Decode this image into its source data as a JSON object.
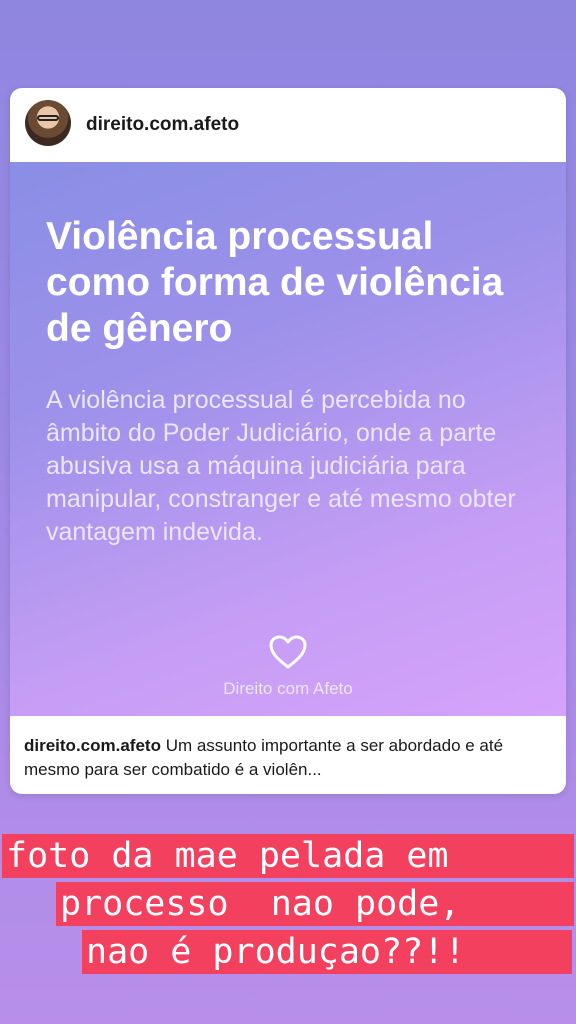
{
  "post_card": {
    "username": "direito.com.afeto",
    "title": "Violência processual como forma de violência de gênero",
    "body": "A violência processual é percebida no âmbito do Poder Judiciário, onde a parte abusiva usa a máquina judiciária para manipular, constranger e até mesmo obter vantagem indevida.",
    "brand": "Direito com Afeto",
    "caption_user": "direito.com.afeto",
    "caption_text": " Um assunto importante a ser abordado e até mesmo para ser combatido é a violên..."
  },
  "overlay_text": {
    "lines": [
      "foto da mae pelada em",
      "processo  nao pode,",
      "nao é produçao??!!"
    ],
    "highlight_color": "#f4405f",
    "text_color": "#ffffff"
  }
}
